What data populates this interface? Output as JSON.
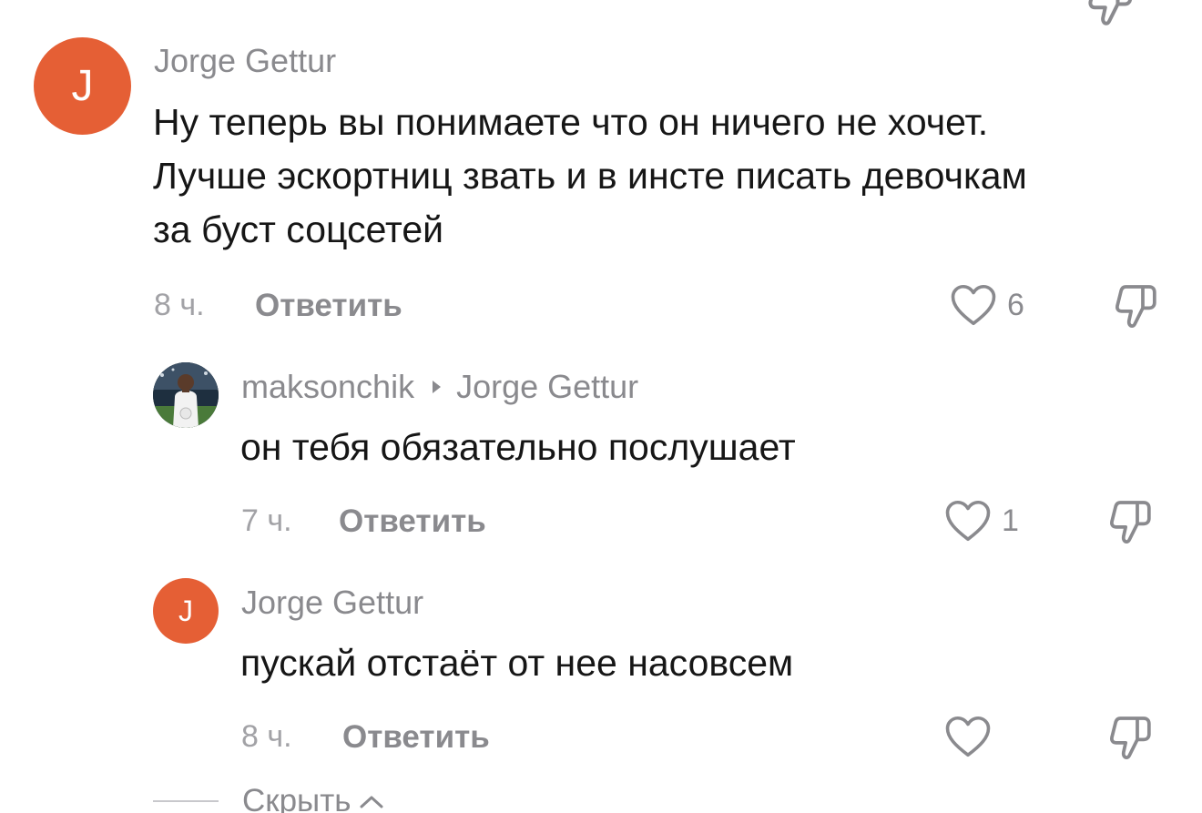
{
  "comments": [
    {
      "avatar_letter": "J",
      "author": "Jorge Gettur",
      "text_lines": [
        "Ну теперь вы понимаете что он ничего не хочет.",
        "Лучше эскортниц звать и в инсте писать девочкам",
        "за буст соцсетей"
      ],
      "time": "8 ч.",
      "reply_label": "Ответить",
      "likes": "6"
    },
    {
      "author": "maksonchik",
      "reply_to": "Jorge Gettur",
      "text_lines": [
        "он тебя обязательно послушает"
      ],
      "time": "7 ч.",
      "reply_label": "Ответить",
      "likes": "1"
    },
    {
      "avatar_letter": "J",
      "author": "Jorge Gettur",
      "text_lines": [
        "пускай отстаёт от нее насовсем"
      ],
      "time": "8 ч.",
      "reply_label": "Ответить",
      "likes": ""
    }
  ],
  "hide_label": "Скрыть",
  "colors": {
    "avatar": "#e55f35",
    "secondary_text": "#8a8a8e",
    "primary_text": "#161616"
  }
}
